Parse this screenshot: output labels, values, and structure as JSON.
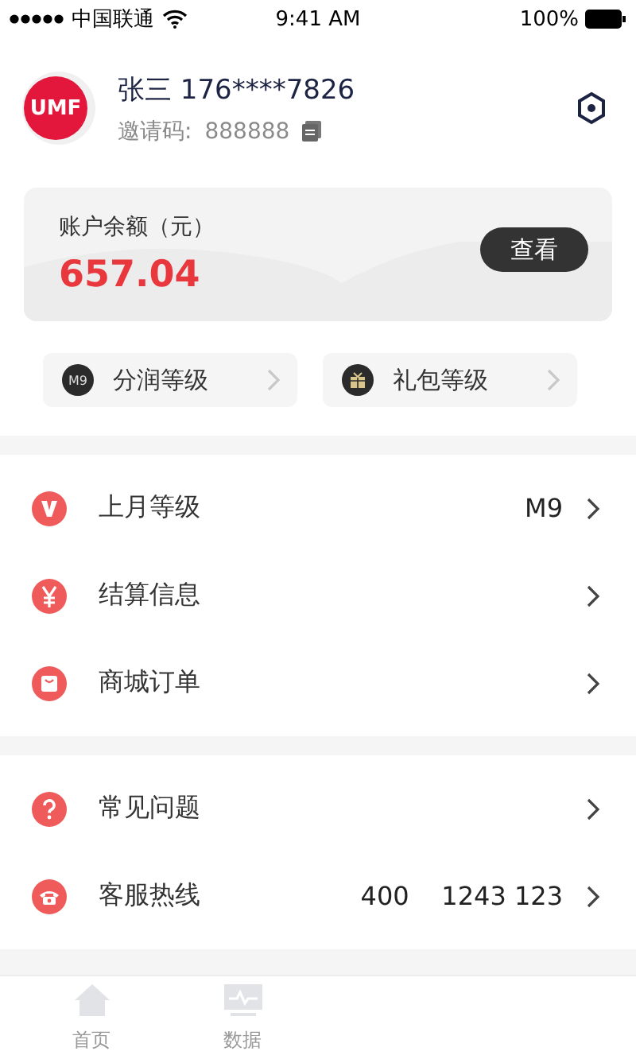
{
  "status_bar": {
    "carrier": "中国联通",
    "time": "9:41 AM",
    "battery": "100%"
  },
  "profile": {
    "avatar_text": "UMF",
    "name": "张三 176****7826",
    "invite_label": "邀请码:",
    "invite_code": "888888"
  },
  "balance": {
    "label": "账户余额（元）",
    "amount": "657.04",
    "button": "查看"
  },
  "levels": [
    {
      "kind": "badge",
      "badge": "M9",
      "label": "分润等级"
    },
    {
      "kind": "gift",
      "label": "礼包等级"
    }
  ],
  "menu_groups": [
    [
      {
        "label": "上月等级",
        "value": "M9"
      },
      {
        "label": "结算信息"
      },
      {
        "label": "商城订单"
      }
    ],
    [
      {
        "label": "常见问题"
      },
      {
        "label": "客服热线",
        "value": "400    1243 123"
      }
    ]
  ],
  "tab_bar": [
    {
      "label": "首页",
      "selected": false
    },
    {
      "label": "数据",
      "selected": false
    }
  ]
}
